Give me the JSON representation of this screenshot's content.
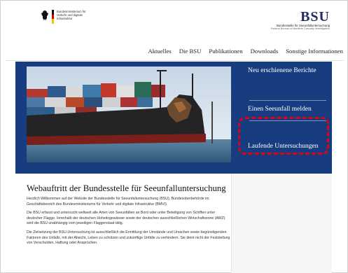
{
  "header": {
    "gov_logo_text": "Bundesministerium für Verkehr und digitale Infrastruktur",
    "bsu_logo_prefix": "BSU",
    "bsu_logo_name": "BSU",
    "bsu_subtitle": "Bundesstelle für Seeunfalluntersuchung",
    "bsu_subtitle_en": "Federal Bureau of Maritime Casualty Investigation"
  },
  "nav": {
    "items": [
      "Aktuelles",
      "Die BSU",
      "Publikationen",
      "Downloads",
      "Sonstige Informationen"
    ]
  },
  "hero": {
    "side_links": [
      "Neu erschienene Berichte",
      "Einen Seeunfall melden",
      "Laufende Untersuchungen"
    ]
  },
  "main": {
    "title": "Webauftritt der Bundesstelle für Seeunfalluntersuchung",
    "paragraphs": [
      "Herzlich Willkommen auf der Website der Bundesstelle für Seeunfalluntersuchung (BSU), Bundesoberbehörde im Geschäftsbereich des Bundesministeriums für Verkehr und digitale Infrastruktur (BMVI).",
      "Die BSU erfasst und untersucht weltweit alle Arten von Seeunfällen an Bord oder unter Beteiligung von Schiffen unter deutscher Flagge. Innerhalb der deutschen Hoheitsgewässer sowie der deutschen ausschließlichen Wirtschaftszone (AWZ) wird die BSU unabhängig vom jeweiligen Flaggenstaat tätig.",
      "Die Zielsetzung der BSU-Untersuchung ist ausschließlich die Ermittlung der Umstände und Ursachen sowie begünstigenden Faktoren des Unfalls, mit der Absicht, Leben zu schützen und zukünftige Unfälle zu verhindern. Sie dient nicht der Feststellung von Verschulden, Haftung oder Ansprüchen."
    ]
  },
  "colors": {
    "brand_blue": "#173d80",
    "highlight_red": "#e00018"
  }
}
